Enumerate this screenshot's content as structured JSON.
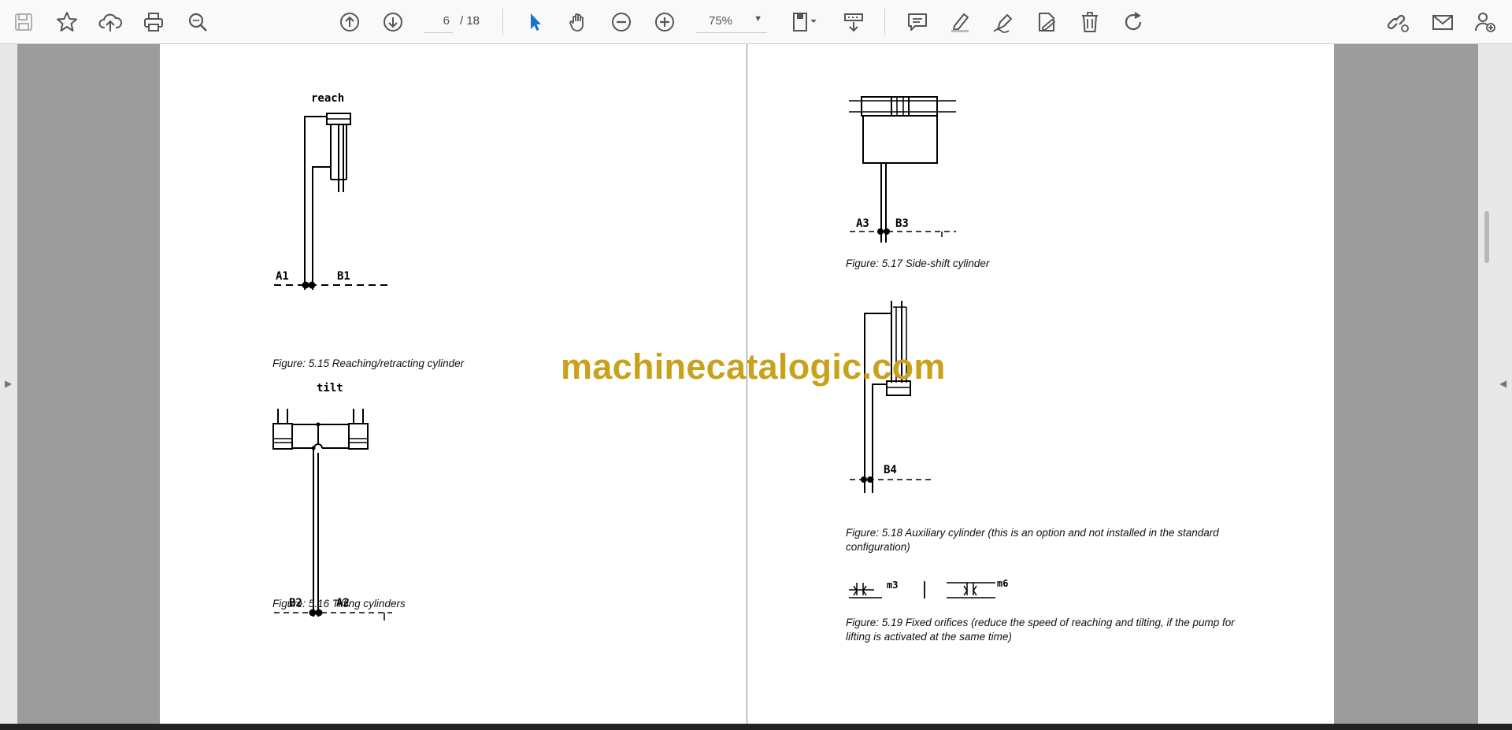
{
  "toolbar": {
    "page_current": "6",
    "page_total": "/ 18",
    "zoom": "75%",
    "icons": [
      "save-icon",
      "bookmark-star-icon",
      "upload-cloud-icon",
      "print-icon",
      "find-zoom-icon",
      "previous-page-icon",
      "next-page-icon",
      "select-cursor-icon",
      "hand-pan-icon",
      "zoom-out-icon",
      "zoom-in-icon",
      "page-fit-icon",
      "scroll-mode-icon",
      "comment-icon",
      "highlight-icon",
      "draw-icon",
      "fill-sign-icon",
      "delete-icon",
      "rotate-icon",
      "share-link-icon",
      "email-icon",
      "add-user-icon"
    ],
    "accent_color": "#1a73c9"
  },
  "document": {
    "left_page": {
      "fig515": {
        "label_top": "reach",
        "label_a": "A1",
        "label_b": "B1",
        "caption": "Figure: 5.15 Reaching/retracting cylinder"
      },
      "fig516": {
        "label_top": "tilt",
        "label_a": "A2",
        "label_b": "B2",
        "caption": "Figure: 5.16 Tilting cylinders"
      }
    },
    "right_page": {
      "fig517": {
        "label_a": "A3",
        "label_b": "B3",
        "caption": "Figure: 5.17 Side-shift cylinder"
      },
      "fig518": {
        "label_b": "B4",
        "caption": "Figure: 5.18 Auxiliary cylinder (this is an option and not installed in the standard configuration)"
      },
      "fig519": {
        "label_1": "m3",
        "label_2": "m6",
        "caption": "Figure: 5.19 Fixed orifices (reduce the speed of reaching and tilting, if the pump for lifting is activated at the same time)"
      }
    }
  },
  "watermark": "machinecatalogic.com"
}
